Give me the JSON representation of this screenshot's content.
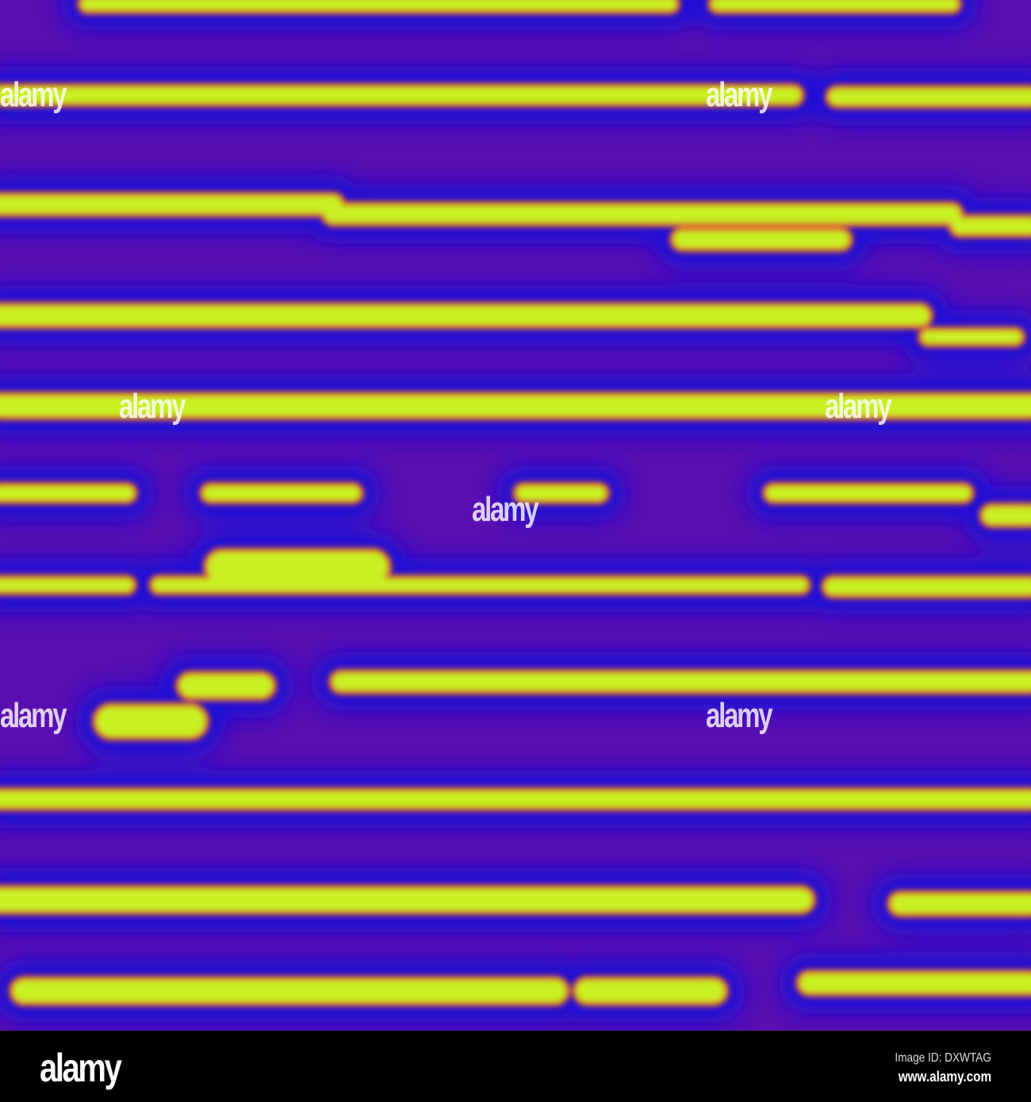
{
  "watermark": {
    "logo": "alamy",
    "image_id": "Image ID: DXWTAG",
    "website": "www.alamy.com"
  },
  "colors": {
    "background": "#5a0fb0",
    "band": "#1a10d8",
    "stripe": "#c8f020",
    "edge": "#e05030"
  }
}
